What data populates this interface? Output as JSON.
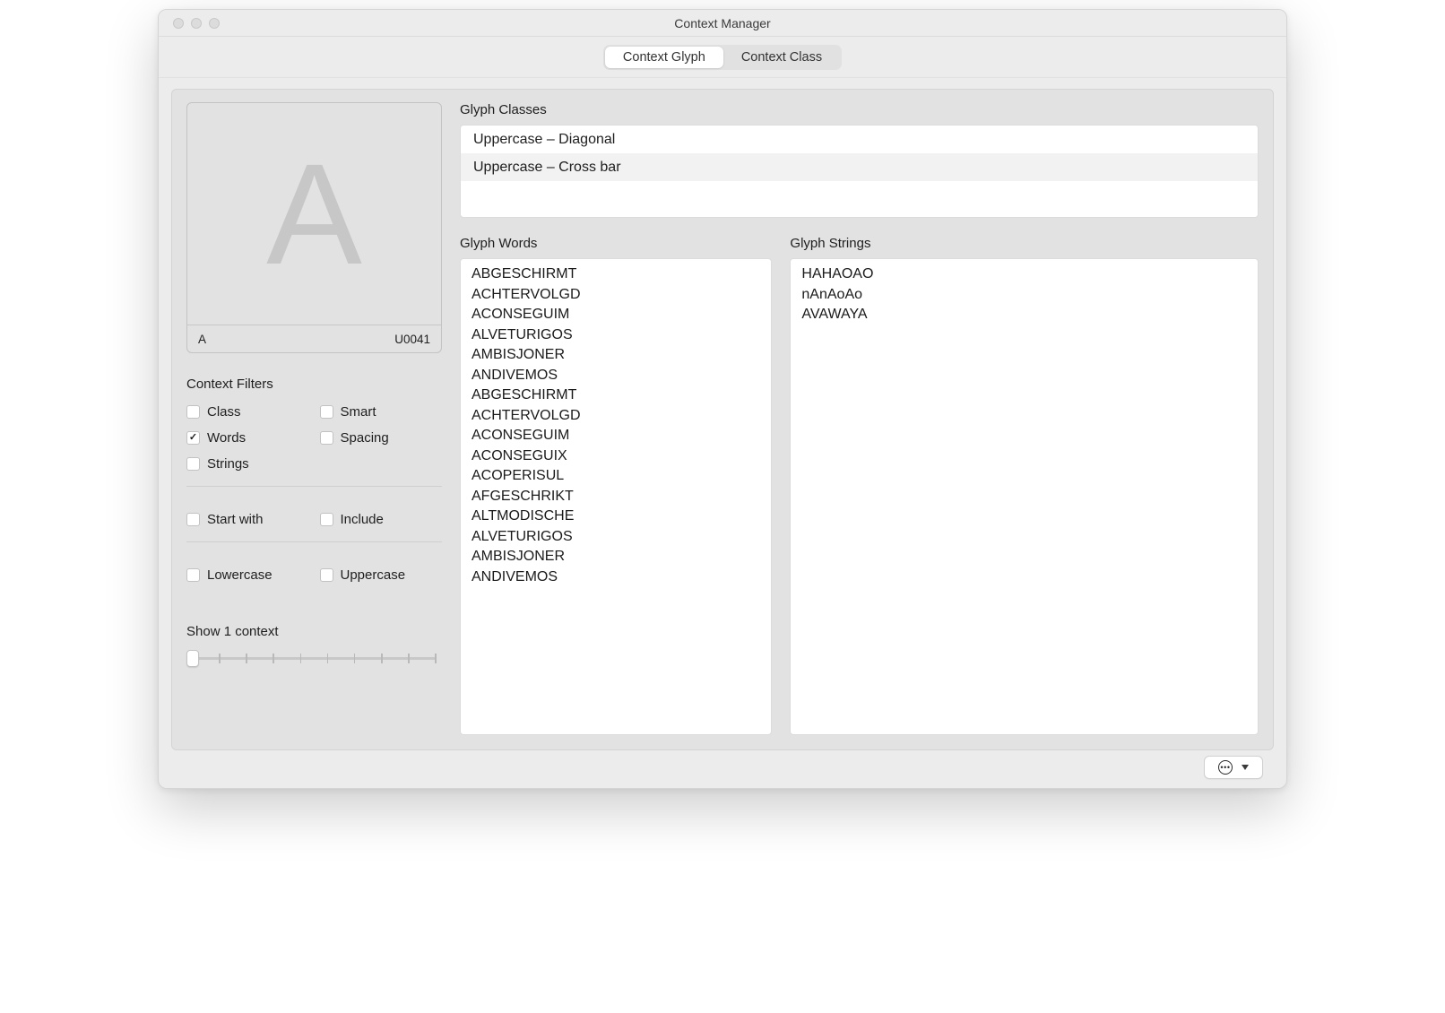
{
  "window": {
    "title": "Context Manager"
  },
  "tabs": {
    "glyph": "Context Glyph",
    "klass": "Context Class"
  },
  "glyph": {
    "display": "A",
    "name": "A",
    "unicode": "U0041"
  },
  "filters": {
    "title": "Context Filters",
    "class": "Class",
    "smart": "Smart",
    "words": "Words",
    "spacing": "Spacing",
    "strings": "Strings",
    "start_with": "Start with",
    "include": "Include",
    "lowercase": "Lowercase",
    "uppercase": "Uppercase"
  },
  "slider": {
    "label": "Show 1 context"
  },
  "sections": {
    "glyph_classes": "Glyph Classes",
    "glyph_words": "Glyph Words",
    "glyph_strings": "Glyph Strings"
  },
  "glyph_classes": [
    "Uppercase – Diagonal",
    "Uppercase – Cross bar"
  ],
  "glyph_words": [
    "ABGESCHIRMT",
    "ACHTERVOLGD",
    "ACONSEGUIM",
    "ALVETURIGOS",
    "AMBISJONER",
    "ANDIVEMOS",
    "ABGESCHIRMT",
    "ACHTERVOLGD",
    "ACONSEGUIM",
    "ACONSEGUIX",
    "ACOPERISUL",
    "AFGESCHRIKT",
    "ALTMODISCHE",
    "ALVETURIGOS",
    "AMBISJONER",
    "ANDIVEMOS"
  ],
  "glyph_strings": [
    "HAHAOAO",
    "nAnAoAo",
    "AVAWAYA"
  ]
}
